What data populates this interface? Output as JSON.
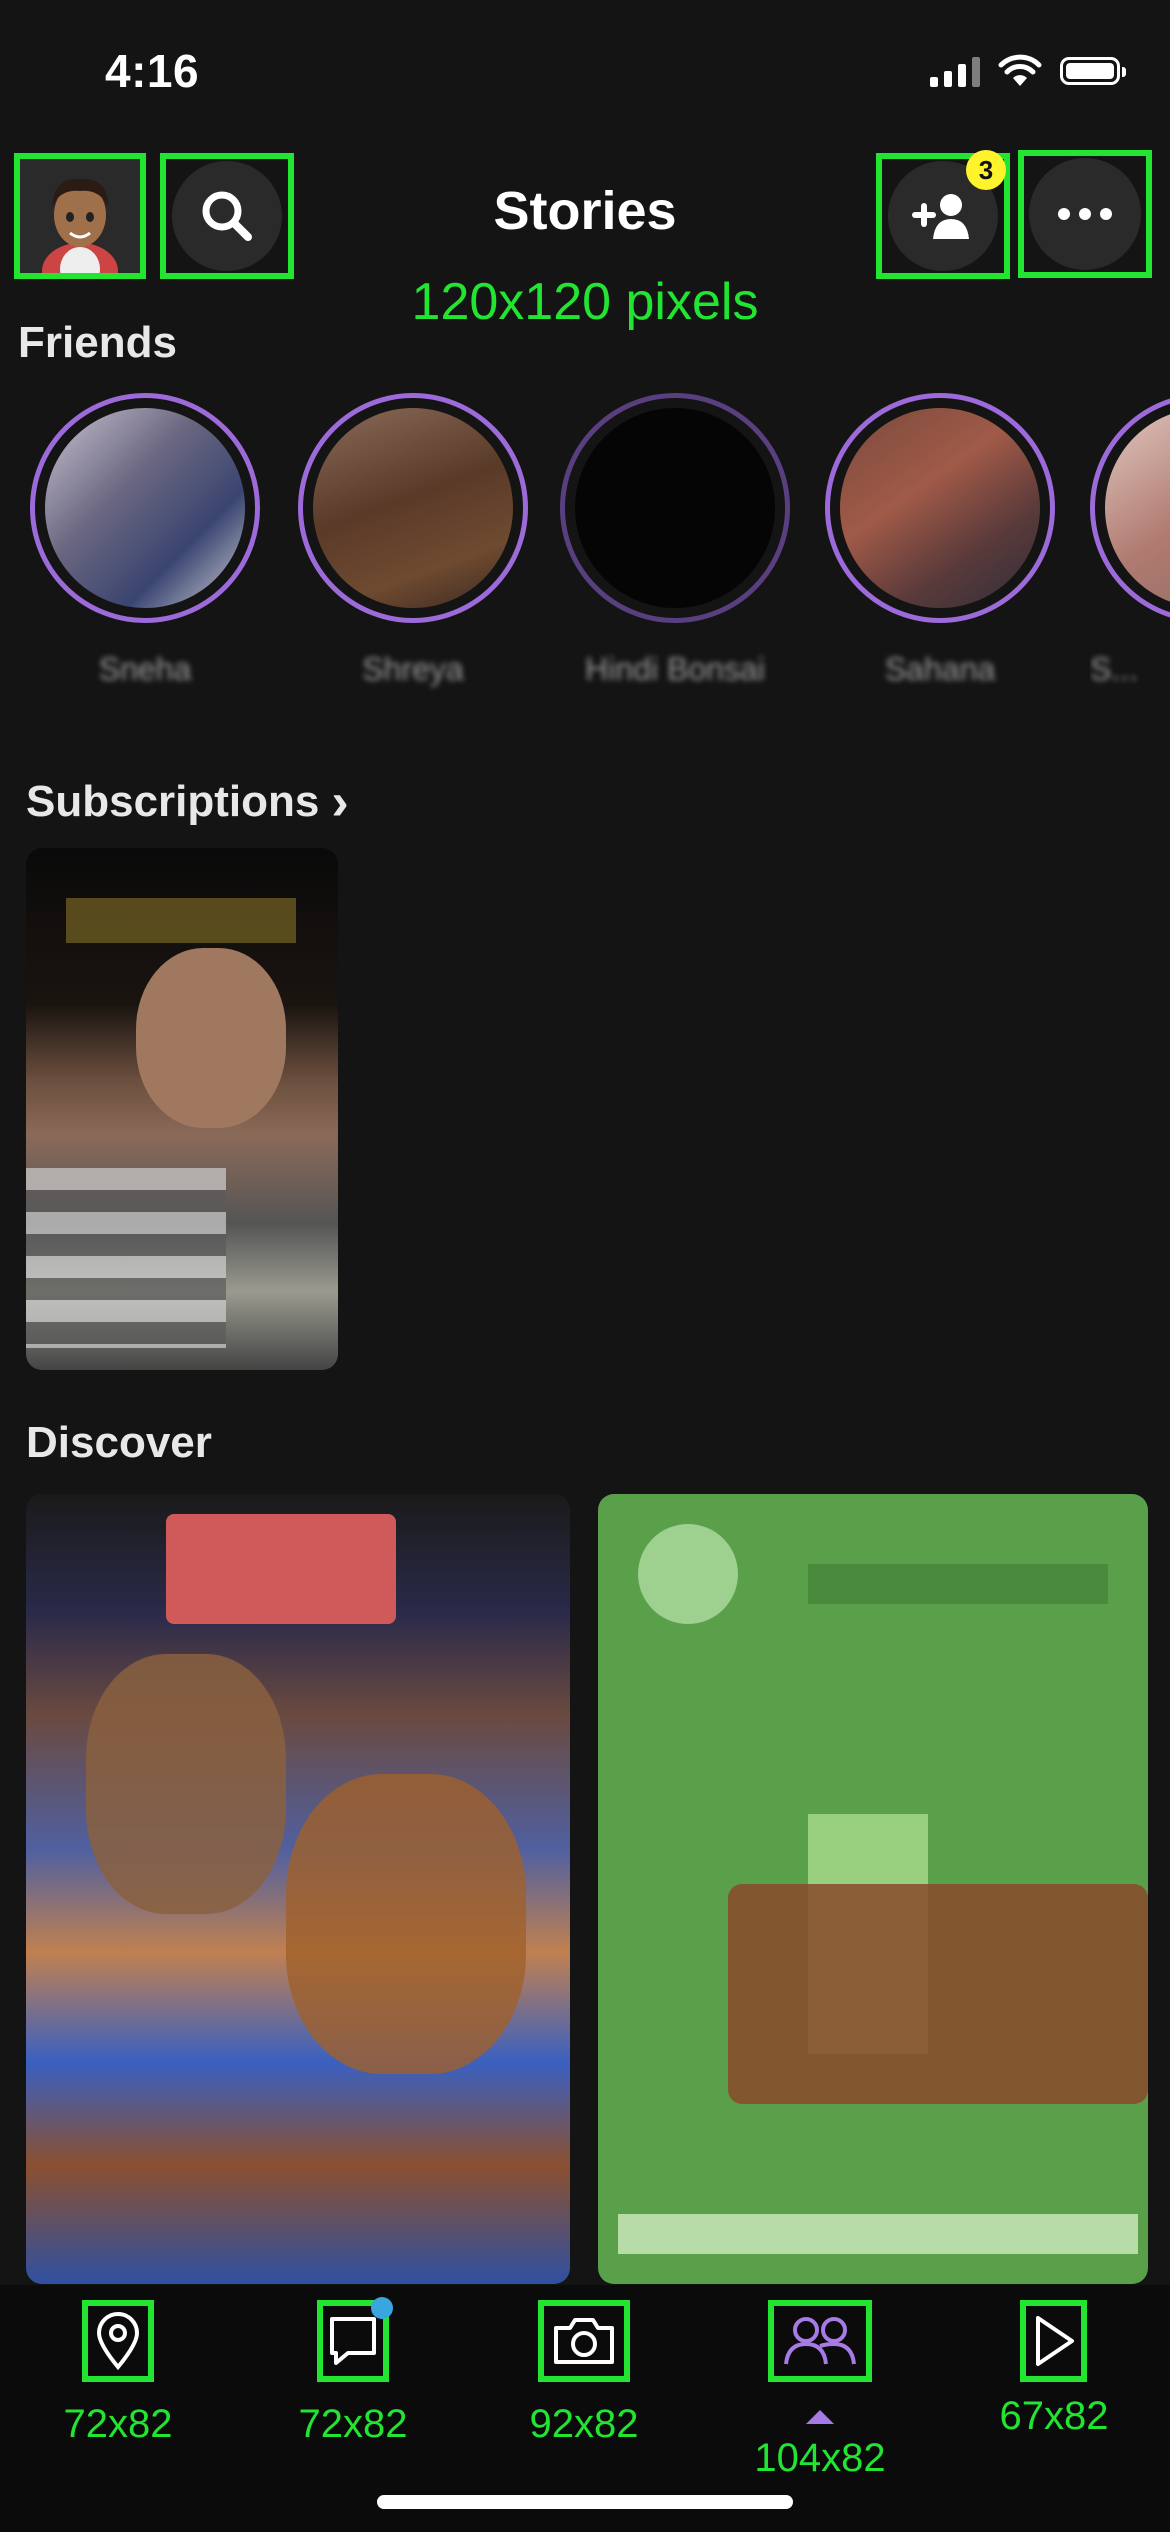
{
  "status_bar": {
    "time": "4:16"
  },
  "header": {
    "title": "Stories",
    "size_annotation": "120x120 pixels",
    "add_friend_badge": "3"
  },
  "friends": {
    "heading": "Friends",
    "items": [
      {
        "name": "Sneha",
        "ring_color": "#9c6ad9"
      },
      {
        "name": "Shreya",
        "ring_color": "#9c6ad9"
      },
      {
        "name": "Hindi Bonsai",
        "ring_color": "#9c6ad9"
      },
      {
        "name": "Sahana",
        "ring_color": "#9c6ad9"
      },
      {
        "name": "S...",
        "ring_color": "#9c6ad9"
      }
    ]
  },
  "subscriptions": {
    "heading": "Subscriptions",
    "chevron": "›"
  },
  "discover": {
    "heading": "Discover"
  },
  "bottom_nav": {
    "items": [
      {
        "icon": "map-pin-icon",
        "size_label": "72x82"
      },
      {
        "icon": "chat-icon",
        "size_label": "72x82"
      },
      {
        "icon": "camera-icon",
        "size_label": "92x82"
      },
      {
        "icon": "friends-icon",
        "size_label": "104x82",
        "active": true
      },
      {
        "icon": "play-icon",
        "size_label": "67x82"
      }
    ]
  },
  "colors": {
    "accent_purple": "#9c6ad9",
    "annotation_green": "#22e532",
    "badge_yellow": "#fff32b"
  }
}
